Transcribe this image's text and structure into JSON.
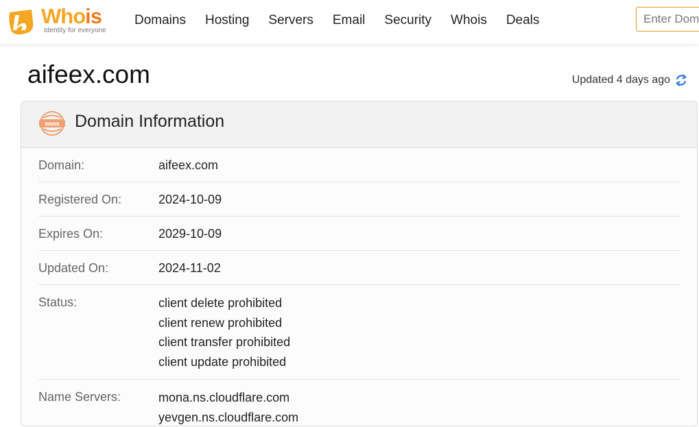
{
  "brand": {
    "name_part1": "Who",
    "name_part2": "is",
    "tagline": "Identity for everyone"
  },
  "nav": {
    "items": [
      "Domains",
      "Hosting",
      "Servers",
      "Email",
      "Security",
      "Whois",
      "Deals"
    ]
  },
  "search": {
    "placeholder": "Enter Domain"
  },
  "page": {
    "title": "aifeex.com",
    "updated_text": "Updated 4 days ago"
  },
  "domain_info": {
    "title": "Domain Information",
    "www_icon_label": "www",
    "rows": [
      {
        "label": "Domain:",
        "values": [
          "aifeex.com"
        ]
      },
      {
        "label": "Registered On:",
        "values": [
          "2024-10-09"
        ]
      },
      {
        "label": "Expires On:",
        "values": [
          "2029-10-09"
        ]
      },
      {
        "label": "Updated On:",
        "values": [
          "2024-11-02"
        ]
      },
      {
        "label": "Status:",
        "values": [
          "client delete prohibited",
          "client renew prohibited",
          "client transfer prohibited",
          "client update prohibited"
        ]
      },
      {
        "label": "Name Servers:",
        "values": [
          "mona.ns.cloudflare.com",
          "yevgen.ns.cloudflare.com"
        ]
      }
    ]
  },
  "colors": {
    "brand_orange": "#f5a623",
    "brand_dark_orange": "#f07c1f",
    "refresh_blue": "#2a7ae2"
  },
  "icons": {
    "logo": "whois-logo-icon",
    "www": "www-globe-icon",
    "refresh": "refresh-icon"
  }
}
